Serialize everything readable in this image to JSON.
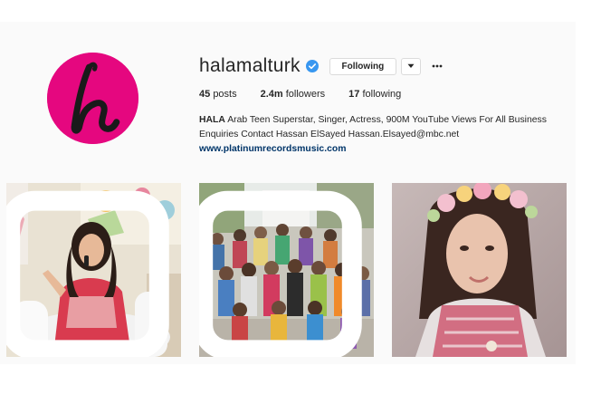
{
  "profile": {
    "username": "halamalturk",
    "follow_button": "Following",
    "stats": [
      {
        "count": "45",
        "label": "posts"
      },
      {
        "count": "2.4m",
        "label": "followers"
      },
      {
        "count": "17",
        "label": "following"
      }
    ],
    "bio_name": "HALA",
    "bio_text": "Arab Teen Superstar, Singer, Actress, 900M YouTube Views For All Business Enquiries Contact Hassan ElSayed Hassan.Elsayed@mbc.net",
    "website": "www.platinumrecordsmusic.com"
  },
  "icons": {
    "verified": "verified-badge-icon",
    "dropdown": "chevron-down-icon",
    "more": "more-options-icon",
    "multi": "multiple-photos-icon"
  },
  "colors": {
    "avatar_bg": "#e5077f",
    "verified": "#3897f0",
    "link": "#003569"
  },
  "posts": [
    {
      "alt": "singer-with-microphone"
    },
    {
      "alt": "group-of-children"
    },
    {
      "alt": "selfie-with-flower-crown"
    }
  ]
}
